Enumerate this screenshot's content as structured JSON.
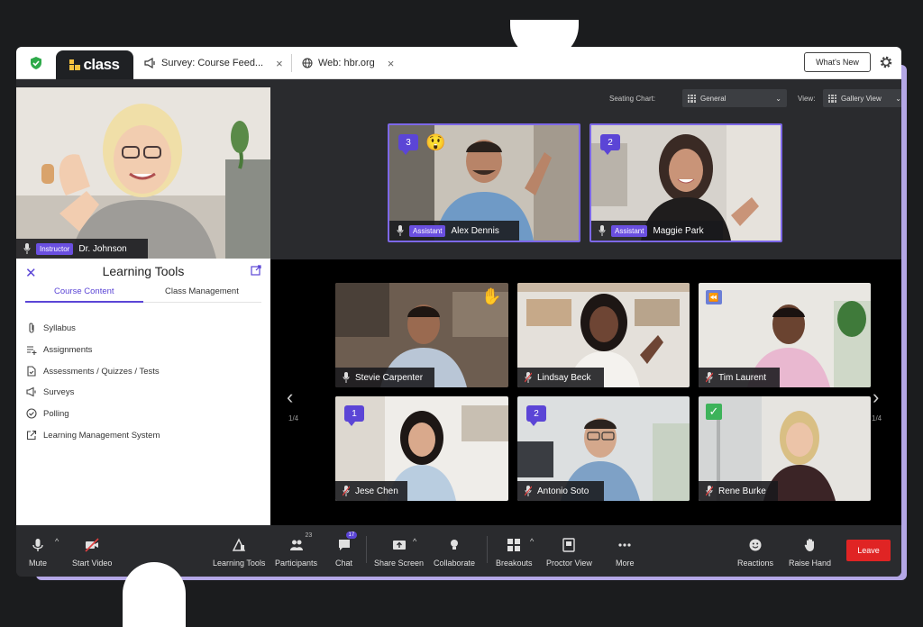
{
  "tabs": {
    "app_name": "class",
    "tab1_label": "Survey: Course Feed...",
    "tab2_label": "Web: hbr.org",
    "close_glyph": "×",
    "whats_new": "What's New"
  },
  "instructor": {
    "role": "Instructor",
    "name": "Dr. Johnson"
  },
  "panel": {
    "title": "Learning Tools",
    "close_glyph": "✕",
    "tabs": [
      "Course Content",
      "Class Management"
    ],
    "items": [
      {
        "label": "Syllabus",
        "icon": "paperclip-icon"
      },
      {
        "label": "Assignments",
        "icon": "list-add-icon"
      },
      {
        "label": "Assessments / Quizzes / Tests",
        "icon": "document-icon"
      },
      {
        "label": "Surveys",
        "icon": "megaphone-icon"
      },
      {
        "label": "Polling",
        "icon": "check-circle-icon"
      },
      {
        "label": "Learning Management System",
        "icon": "external-link-icon"
      }
    ]
  },
  "stage": {
    "seating_label": "Seating Chart:",
    "seating_value": "General",
    "view_label": "View:",
    "view_value": "Gallery View",
    "page_left": "1/4",
    "page_right": "1/4"
  },
  "assistants": [
    {
      "role": "Assistant",
      "name": "Alex Dennis",
      "chat_count": "3",
      "emoji": "😲"
    },
    {
      "role": "Assistant",
      "name": "Maggie Park",
      "chat_count": "2"
    }
  ],
  "students": [
    {
      "name": "Stevie Carpenter",
      "emoji": "✋"
    },
    {
      "name": "Lindsay Beck"
    },
    {
      "name": "Tim Laurent",
      "status": "rewind-icon",
      "rewind_glyph": "⏪"
    },
    {
      "name": "Jese Chen",
      "chat_count": "1"
    },
    {
      "name": "Antonio Soto",
      "chat_count": "2"
    },
    {
      "name": "Rene Burke",
      "status": "check-icon",
      "check_glyph": "✓"
    }
  ],
  "toolbar": {
    "mute": "Mute",
    "start_video": "Start Video",
    "learning_tools": "Learning Tools",
    "participants": "Participants",
    "participants_count": "23",
    "chat": "Chat",
    "chat_count": "17",
    "share_screen": "Share Screen",
    "collaborate": "Collaborate",
    "breakouts": "Breakouts",
    "proctor_view": "Proctor View",
    "more": "More",
    "reactions": "Reactions",
    "raise_hand": "Raise Hand",
    "leave": "Leave",
    "caret_glyph": "^"
  },
  "colors": {
    "accent": "#5b45d6",
    "leave": "#e02424",
    "frame": "#b4a7e6"
  }
}
